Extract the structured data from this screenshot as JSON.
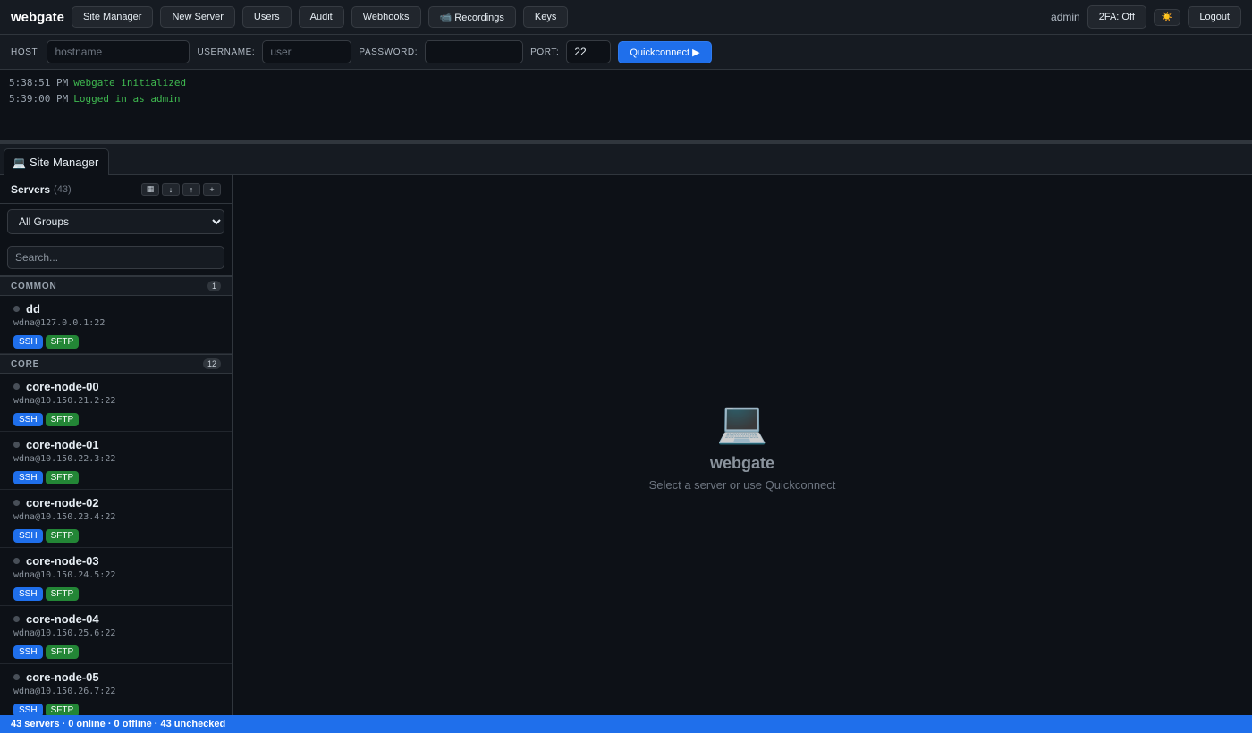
{
  "app": {
    "brand": "webgate"
  },
  "nav": {
    "site_manager": "Site Manager",
    "new_server": "New Server",
    "users": "Users",
    "audit": "Audit",
    "webhooks": "Webhooks",
    "recordings": "📹 Recordings",
    "keys": "Keys"
  },
  "user": {
    "name": "admin",
    "twofa": "2FA: Off",
    "theme_icon": "☀️",
    "logout": "Logout"
  },
  "quickconnect": {
    "host_label": "HOST:",
    "host_placeholder": "hostname",
    "user_label": "USERNAME:",
    "user_placeholder": "user",
    "password_label": "PASSWORD:",
    "port_label": "PORT:",
    "port_value": "22",
    "button": "Quickconnect ▶"
  },
  "log": [
    {
      "time": "5:38:51 PM",
      "message": "webgate initialized"
    },
    {
      "time": "5:39:00 PM",
      "message": "Logged in as admin"
    }
  ],
  "tabs": [
    {
      "icon": "💻",
      "label": "Site Manager"
    }
  ],
  "sidebar": {
    "title": "Servers",
    "count": "(43)",
    "tools": [
      "▦",
      "↓",
      "↑",
      "+"
    ],
    "group_filter": "All Groups",
    "search_placeholder": "Search...",
    "groups": [
      {
        "name": "COMMON",
        "count": "1",
        "servers": [
          {
            "name": "dd",
            "address": "wdna@127.0.0.1:22",
            "tags": [
              "SSH",
              "SFTP"
            ]
          }
        ]
      },
      {
        "name": "CORE",
        "count": "12",
        "servers": [
          {
            "name": "core-node-00",
            "address": "wdna@10.150.21.2:22",
            "tags": [
              "SSH",
              "SFTP"
            ]
          },
          {
            "name": "core-node-01",
            "address": "wdna@10.150.22.3:22",
            "tags": [
              "SSH",
              "SFTP"
            ]
          },
          {
            "name": "core-node-02",
            "address": "wdna@10.150.23.4:22",
            "tags": [
              "SSH",
              "SFTP"
            ]
          },
          {
            "name": "core-node-03",
            "address": "wdna@10.150.24.5:22",
            "tags": [
              "SSH",
              "SFTP"
            ]
          },
          {
            "name": "core-node-04",
            "address": "wdna@10.150.25.6:22",
            "tags": [
              "SSH",
              "SFTP"
            ]
          },
          {
            "name": "core-node-05",
            "address": "wdna@10.150.26.7:22",
            "tags": [
              "SSH",
              "SFTP"
            ]
          }
        ]
      }
    ]
  },
  "main": {
    "icon": "💻",
    "title": "webgate",
    "subtitle": "Select a server or use Quickconnect"
  },
  "status": {
    "text": "43 servers · 0 online · 0 offline · 43 unchecked"
  },
  "colors": {
    "accent": "#1f6feb",
    "ssh": "#1f6feb",
    "sftp": "#238636",
    "log_ok": "#3fb950",
    "bg": "#0d1117"
  }
}
